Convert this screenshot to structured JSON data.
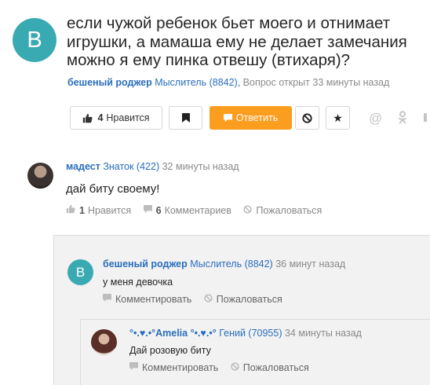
{
  "question": {
    "avatar_letter": "B",
    "title": "если чужой ребенок бьет моего и отнимает игрушки, а мамаша ему не делает замечания можно я ему пинка отвешу (втихаря)?",
    "author": "бешеный роджер",
    "rank": "Мыслитель (8842),",
    "status": "Вопрос открыт 33 минуты назад",
    "like_count": "4",
    "like_label": "Нравится",
    "answer_label": "Ответить",
    "colors": {
      "accent": "#fb9d1f",
      "link": "#2a6ebb",
      "avatar_bg": "#3aaab2"
    }
  },
  "answer": {
    "author": "мадест",
    "rank": "Знаток (422)",
    "time": "32 минуты назад",
    "text": "дай биту своему!",
    "like_count": "1",
    "like_label": "Нравится",
    "comments_count": "6",
    "comments_label": "Комментариев",
    "report_label": "Пожаловаться"
  },
  "comments": [
    {
      "avatar_letter": "B",
      "author": "бешеный роджер",
      "rank": "Мыслитель (8842)",
      "time": "36 минут назад",
      "text": "у меня девочка",
      "comment_label": "Комментировать",
      "report_label": "Пожаловаться"
    },
    {
      "author": "°•.♥.•°Amelia °•.♥.•°",
      "rank": "Гений (70955)",
      "time": "34 минуты назад",
      "text": "Дай розовую биту",
      "comment_label": "Комментировать",
      "report_label": "Пожаловаться"
    }
  ]
}
